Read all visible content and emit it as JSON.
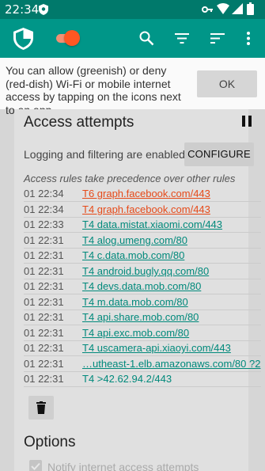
{
  "status_bar": {
    "time": "22:34",
    "icons": [
      "shield-icon",
      "key-icon",
      "wifi-icon",
      "signal-icon",
      "battery-icon"
    ]
  },
  "app_bar": {
    "icons": [
      "app-shield-icon",
      "enable-toggle",
      "search-icon",
      "filter-icon",
      "sort-icon",
      "overflow-menu-icon"
    ],
    "toggle_on": true,
    "accent": "#ff5722",
    "primary": "#009688",
    "primary_dark": "#00796b"
  },
  "hint": {
    "text": "You can allow (greenish) or deny (red-dish) Wi-Fi or mobile internet access by tapping on the icons next to an app",
    "ok_label": "OK"
  },
  "access": {
    "title": "Access attempts",
    "logging_text": "Logging and filtering are enabled",
    "configure_label": "CONFIGURE",
    "precedence_text": "Access rules take precedence over other rules",
    "entries": [
      {
        "time": "01 22:34",
        "text": "T6 graph.facebook.com/443",
        "status": "denied"
      },
      {
        "time": "01 22:34",
        "text": "T4 graph.facebook.com/443",
        "status": "denied"
      },
      {
        "time": "01 22:33",
        "text": "T4 data.mistat.xiaomi.com/443",
        "status": "allowed"
      },
      {
        "time": "01 22:31",
        "text": "T4 alog.umeng.com/80",
        "status": "allowed"
      },
      {
        "time": "01 22:31",
        "text": "T4 c.data.mob.com/80",
        "status": "allowed"
      },
      {
        "time": "01 22:31",
        "text": "T4 android.bugly.qq.com/80",
        "status": "allowed"
      },
      {
        "time": "01 22:31",
        "text": "T4 devs.data.mob.com/80",
        "status": "allowed"
      },
      {
        "time": "01 22:31",
        "text": "T4 m.data.mob.com/80",
        "status": "allowed"
      },
      {
        "time": "01 22:31",
        "text": "T4 api.share.mob.com/80",
        "status": "allowed"
      },
      {
        "time": "01 22:31",
        "text": "T4 api.exc.mob.com/80",
        "status": "allowed"
      },
      {
        "time": "01 22:31",
        "text": "T4 uscamera-api.xiaoyi.com/443",
        "status": "allowed"
      },
      {
        "time": "01 22:31",
        "text": "…utheast-1.elb.amazonaws.com/80 ?2",
        "status": "allowed"
      },
      {
        "time": "01 22:31",
        "text": "T4 >42.62.94.2/443",
        "status": "allowed"
      }
    ]
  },
  "options": {
    "title": "Options",
    "notify_label": "Notify internet access attempts",
    "notify_checked": true
  }
}
